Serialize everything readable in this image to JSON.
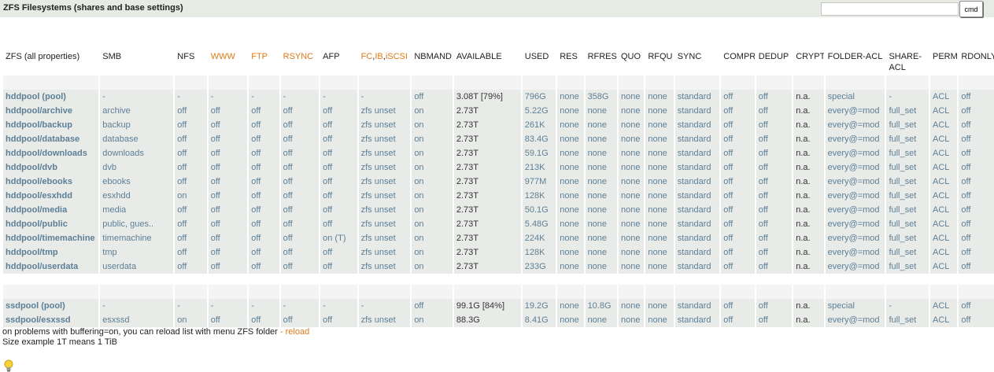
{
  "header": {
    "title": "ZFS Filesystems (shares and base settings)",
    "cmd_value": "",
    "cmd_button": "cmd"
  },
  "table": {
    "headers": [
      "ZFS (all properties)",
      "SMB",
      "NFS",
      "WWW",
      "FTP",
      "RSYNC",
      "AFP",
      "FC,IB,iSCSI",
      "NBMAND",
      "AVAILABLE",
      "USED",
      "RES",
      "RFRES",
      "QUO",
      "RFQU",
      "SYNC",
      "COMPR",
      "DEDUP",
      "CRYPT",
      "FOLDER-ACL",
      "SHARE-ACL",
      "PERM",
      "RDONLY"
    ],
    "fc_parts": [
      "FC",
      ",",
      "IB",
      ",",
      "iSCSI"
    ],
    "groups": [
      {
        "rows": [
          [
            "hddpool (pool)",
            "-",
            "-",
            "-",
            "-",
            "-",
            "-",
            "-",
            "off",
            "3.08T [79%]",
            "796G",
            "none",
            "358G",
            "none",
            "none",
            "standard",
            "off",
            "off",
            "n.a.",
            "special",
            "-",
            "ACL",
            "off"
          ],
          [
            "hddpool/archive",
            "archive",
            "off",
            "off",
            "off",
            "off",
            "off",
            "zfs unset",
            "on",
            "2.73T",
            "5.22G",
            "none",
            "none",
            "none",
            "none",
            "standard",
            "off",
            "off",
            "n.a.",
            "every@=mod",
            "full_set",
            "ACL",
            "off"
          ],
          [
            "hddpool/backup",
            "backup",
            "off",
            "off",
            "off",
            "off",
            "off",
            "zfs unset",
            "on",
            "2.73T",
            "261K",
            "none",
            "none",
            "none",
            "none",
            "standard",
            "off",
            "off",
            "n.a.",
            "every@=mod",
            "full_set",
            "ACL",
            "off"
          ],
          [
            "hddpool/database",
            "database",
            "off",
            "off",
            "off",
            "off",
            "off",
            "zfs unset",
            "on",
            "2.73T",
            "83.4G",
            "none",
            "none",
            "none",
            "none",
            "standard",
            "off",
            "off",
            "n.a.",
            "every@=mod",
            "full_set",
            "ACL",
            "off"
          ],
          [
            "hddpool/downloads",
            "downloads",
            "off",
            "off",
            "off",
            "off",
            "off",
            "zfs unset",
            "on",
            "2.73T",
            "59.1G",
            "none",
            "none",
            "none",
            "none",
            "standard",
            "off",
            "off",
            "n.a.",
            "every@=mod",
            "full_set",
            "ACL",
            "off"
          ],
          [
            "hddpool/dvb",
            "dvb",
            "off",
            "off",
            "off",
            "off",
            "off",
            "zfs unset",
            "on",
            "2.73T",
            "213K",
            "none",
            "none",
            "none",
            "none",
            "standard",
            "off",
            "off",
            "n.a.",
            "every@=mod",
            "full_set",
            "ACL",
            "off"
          ],
          [
            "hddpool/ebooks",
            "ebooks",
            "off",
            "off",
            "off",
            "off",
            "off",
            "zfs unset",
            "on",
            "2.73T",
            "977M",
            "none",
            "none",
            "none",
            "none",
            "standard",
            "off",
            "off",
            "n.a.",
            "every@=mod",
            "full_set",
            "ACL",
            "off"
          ],
          [
            "hddpool/esxhdd",
            "esxhdd",
            "on",
            "off",
            "off",
            "off",
            "off",
            "zfs unset",
            "on",
            "2.73T",
            "128K",
            "none",
            "none",
            "none",
            "none",
            "standard",
            "off",
            "off",
            "n.a.",
            "every@=mod",
            "full_set",
            "ACL",
            "off"
          ],
          [
            "hddpool/media",
            "media",
            "off",
            "off",
            "off",
            "off",
            "off",
            "zfs unset",
            "on",
            "2.73T",
            "50.1G",
            "none",
            "none",
            "none",
            "none",
            "standard",
            "off",
            "off",
            "n.a.",
            "every@=mod",
            "full_set",
            "ACL",
            "off"
          ],
          [
            "hddpool/public",
            "public, gues..",
            "off",
            "off",
            "off",
            "off",
            "off",
            "zfs unset",
            "on",
            "2.73T",
            "5.48G",
            "none",
            "none",
            "none",
            "none",
            "standard",
            "off",
            "off",
            "n.a.",
            "every@=mod",
            "full_set",
            "ACL",
            "off"
          ],
          [
            "hddpool/timemachine",
            "timemachine",
            "off",
            "off",
            "off",
            "off",
            "on (T)",
            "zfs unset",
            "on",
            "2.73T",
            "224K",
            "none",
            "none",
            "none",
            "none",
            "standard",
            "off",
            "off",
            "n.a.",
            "every@=mod",
            "full_set",
            "ACL",
            "off"
          ],
          [
            "hddpool/tmp",
            "tmp",
            "off",
            "off",
            "off",
            "off",
            "off",
            "zfs unset",
            "on",
            "2.73T",
            "128K",
            "none",
            "none",
            "none",
            "none",
            "standard",
            "off",
            "off",
            "n.a.",
            "every@=mod",
            "full_set",
            "ACL",
            "off"
          ],
          [
            "hddpool/userdata",
            "userdata",
            "off",
            "off",
            "off",
            "off",
            "off",
            "zfs unset",
            "on",
            "2.73T",
            "233G",
            "none",
            "none",
            "none",
            "none",
            "standard",
            "off",
            "off",
            "n.a.",
            "every@=mod",
            "full_set",
            "ACL",
            "off"
          ]
        ]
      },
      {
        "rows": [
          [
            "ssdpool (pool)",
            "-",
            "-",
            "-",
            "-",
            "-",
            "-",
            "-",
            "off",
            "99.1G [84%]",
            "19.2G",
            "none",
            "10.8G",
            "none",
            "none",
            "standard",
            "off",
            "off",
            "n.a.",
            "special",
            "-",
            "ACL",
            "off"
          ],
          [
            "ssdpool/esxssd",
            "esxssd",
            "on",
            "off",
            "off",
            "off",
            "off",
            "zfs unset",
            "on",
            "88.3G",
            "8.41G",
            "none",
            "none",
            "none",
            "none",
            "standard",
            "off",
            "off",
            "n.a.",
            "every@=mod",
            "full_set",
            "ACL",
            "off"
          ]
        ]
      }
    ]
  },
  "footer": {
    "line1_pre": "on problems with buffering=on, you can reload list with menu ZFS folder ",
    "line1_link": "- reload",
    "line2": "Size example 1T means 1 TiB"
  },
  "colors": {
    "accent_orange": "#e07a16",
    "link_blue": "#5c7f96",
    "row_bg": "#e9ebe9",
    "titlebar_bg": "#e6ebe3"
  },
  "icons": {
    "bulb": "lightbulb-icon"
  }
}
